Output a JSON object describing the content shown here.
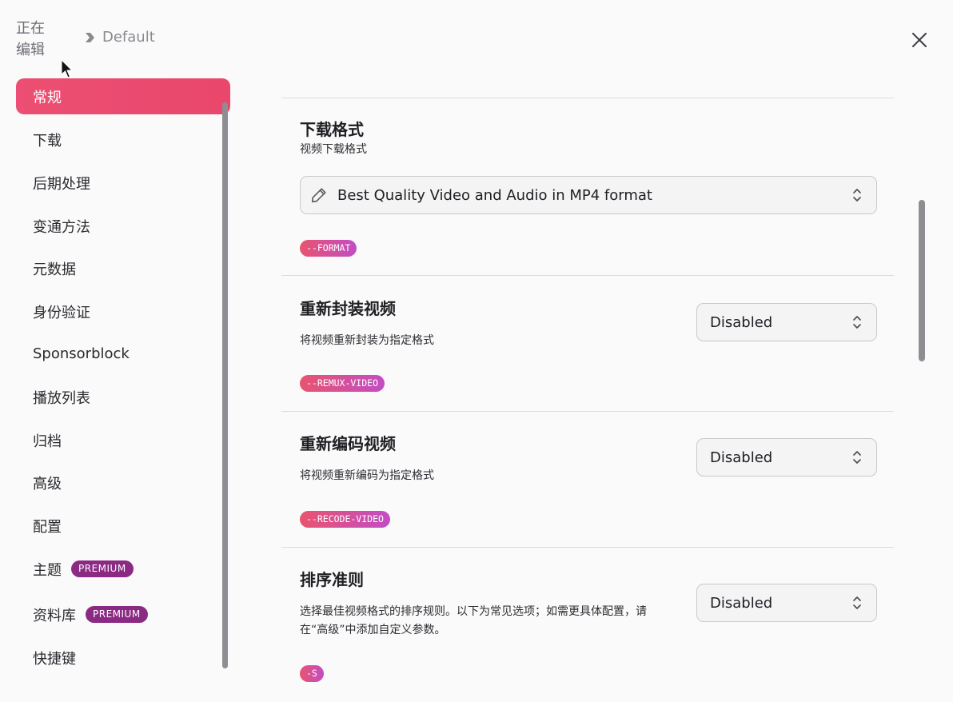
{
  "header": {
    "editing_label": "正在编辑",
    "breadcrumb_profile": "Default"
  },
  "sidebar": {
    "items": [
      {
        "label": "常规",
        "active": true
      },
      {
        "label": "下载"
      },
      {
        "label": "后期处理"
      },
      {
        "label": "变通方法"
      },
      {
        "label": "元数据"
      },
      {
        "label": "身份验证"
      },
      {
        "label": "Sponsorblock"
      },
      {
        "label": "播放列表"
      },
      {
        "label": "归档"
      },
      {
        "label": "高级"
      },
      {
        "label": "配置"
      },
      {
        "label": "主题",
        "badge": "PREMIUM"
      },
      {
        "label": "资料库",
        "badge": "PREMIUM"
      },
      {
        "label": "快捷键"
      }
    ]
  },
  "sections": [
    {
      "title": "下载格式",
      "description": "视频下载格式",
      "value": "Best Quality Video and Audio in MP4 format",
      "flag": "--FORMAT"
    },
    {
      "title": "重新封装视频",
      "description": "将视频重新封装为指定格式",
      "value": "Disabled",
      "flag": "--REMUX-VIDEO"
    },
    {
      "title": "重新编码视频",
      "description": "将视频重新编码为指定格式",
      "value": "Disabled",
      "flag": "--RECODE-VIDEO"
    },
    {
      "title": "排序准则",
      "description_line1": "选择最佳视频格式的排序规则。以下为常见选项；如需更具体配置，请",
      "description_line2": "在“高级”中添加自定义参数。",
      "value": "Disabled",
      "flag": "-S"
    }
  ],
  "colors": {
    "accent": "#ec4f73",
    "premium_badge": "#8b2a83",
    "tag_gradient_start": "#e8546f",
    "tag_gradient_end": "#c24dc5"
  },
  "icons": [
    "chevron-right-icon",
    "close-icon",
    "pencil-icon",
    "chevron-updown-icon",
    "mouse-cursor-icon"
  ]
}
